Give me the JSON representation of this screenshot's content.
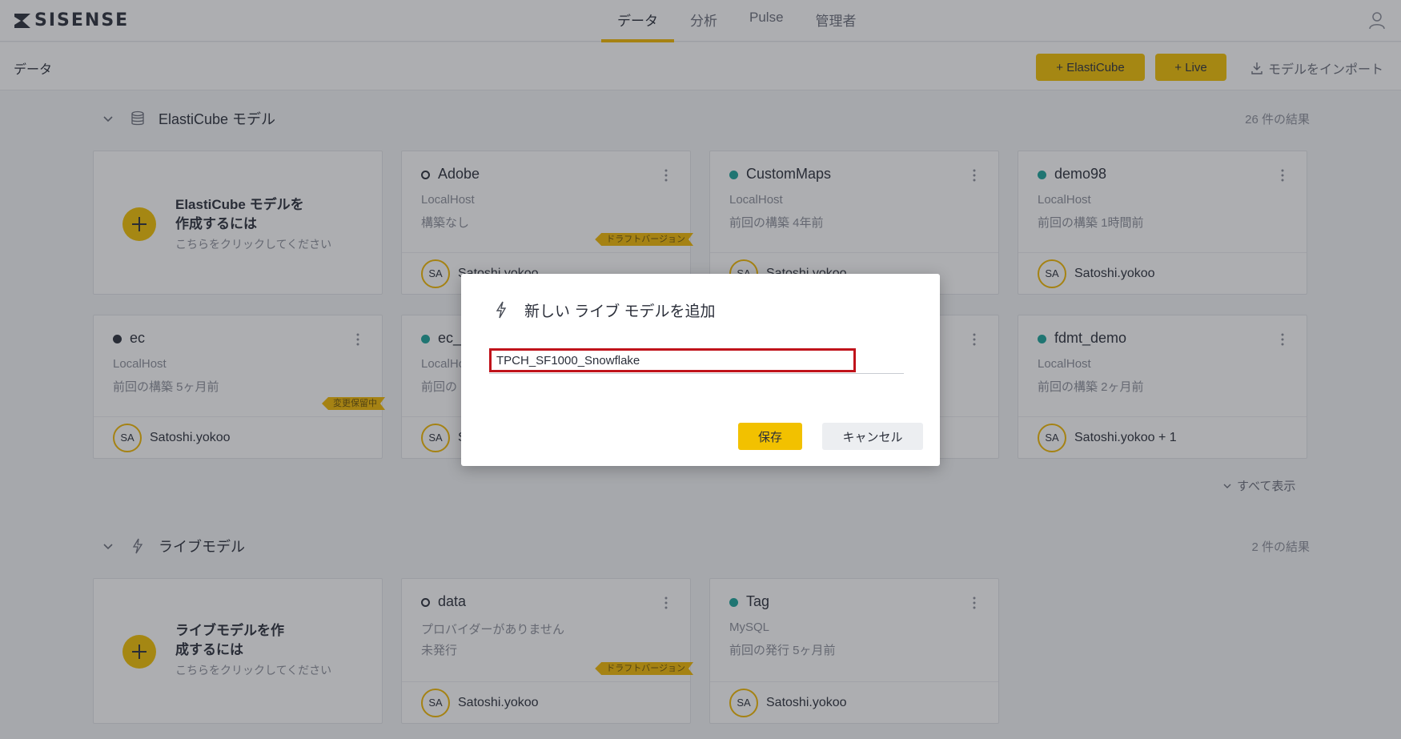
{
  "nav": {
    "logo_text": "SISENSE",
    "tabs": [
      {
        "label": "データ",
        "active": true
      },
      {
        "label": "分析",
        "active": false
      },
      {
        "label": "Pulse",
        "active": false
      },
      {
        "label": "管理者",
        "active": false
      }
    ]
  },
  "toolbar": {
    "page_title": "データ",
    "add_elasticube_label": "+ ElastiCube",
    "add_live_label": "+ Live",
    "import_label": "モデルをインポート"
  },
  "elasticube_section": {
    "title": "ElastiCube モデル",
    "count": "26 件の結果",
    "create_card": {
      "title": "ElastiCube モデルを作成するには",
      "subtitle": "こちらをクリックしてください"
    },
    "cards": [
      {
        "name": "Adobe",
        "status": "hollow",
        "host": "LocalHost",
        "build": "構築なし",
        "ribbon": "ドラフトバージョン",
        "avatar": "SA",
        "owner": "Satoshi.yokoo"
      },
      {
        "name": "CustomMaps",
        "status": "green",
        "host": "LocalHost",
        "build": "前回の構築 4年前",
        "ribbon": "",
        "avatar": "SA",
        "owner": "Satoshi.yokoo"
      },
      {
        "name": "demo98",
        "status": "green",
        "host": "LocalHost",
        "build": "前回の構築 1時間前",
        "ribbon": "",
        "avatar": "SA",
        "owner": "Satoshi.yokoo"
      },
      {
        "name": "ec",
        "status": "dark",
        "host": "LocalHost",
        "build": "前回の構築 5ヶ月前",
        "ribbon": "変更保留中",
        "avatar": "SA",
        "owner": "Satoshi.yokoo"
      },
      {
        "name": "ec_s",
        "status": "green",
        "host": "LocalHost",
        "build": "前回の",
        "ribbon": "",
        "avatar": "SA",
        "owner": "S"
      },
      {
        "name": "",
        "status": "none",
        "host": "",
        "build": "",
        "ribbon": "",
        "avatar": "",
        "owner": ""
      },
      {
        "name": "fdmt_demo",
        "status": "green",
        "host": "LocalHost",
        "build": "前回の構築 2ヶ月前",
        "ribbon": "",
        "avatar": "SA",
        "owner": "Satoshi.yokoo + 1"
      }
    ],
    "show_all": "すべて表示"
  },
  "live_section": {
    "title": "ライブモデル",
    "count": "2 件の結果",
    "create_card": {
      "title": "ライブモデルを作成するには",
      "subtitle": "こちらをクリックしてください"
    },
    "cards": [
      {
        "name": "data",
        "status": "hollow",
        "host": "プロバイダーがありません",
        "build": "未発行",
        "ribbon": "ドラフトバージョン",
        "avatar": "SA",
        "owner": "Satoshi.yokoo"
      },
      {
        "name": "Tag",
        "status": "green",
        "host": "MySQL",
        "build": "前回の発行 5ヶ月前",
        "ribbon": "",
        "avatar": "SA",
        "owner": "Satoshi.yokoo"
      }
    ]
  },
  "modal": {
    "title": "新しい ライブ モデルを追加",
    "name_value": "TPCH_SF1000_Snowflake",
    "save_label": "保存",
    "cancel_label": "キャンセル"
  },
  "colors": {
    "accent": "#f2c100",
    "status_green": "#1aa39a",
    "highlight_red": "#c0131b"
  }
}
